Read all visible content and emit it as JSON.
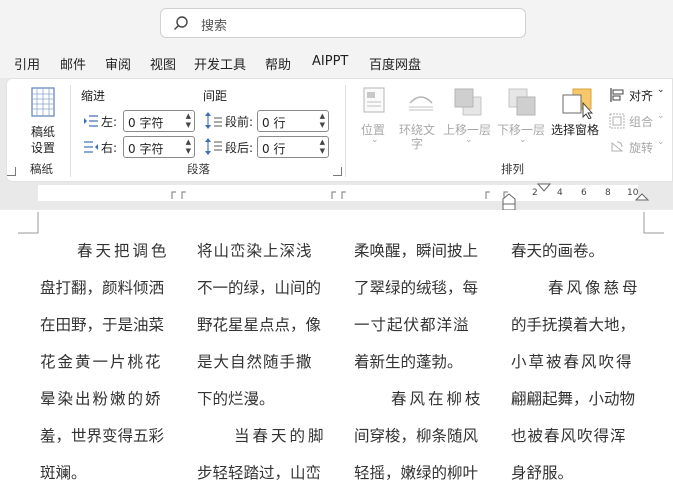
{
  "search": {
    "placeholder": "搜索",
    "icon": "search-icon"
  },
  "menu": {
    "tabs": [
      "引用",
      "邮件",
      "审阅",
      "视图",
      "开发工具",
      "帮助",
      "AIPPT",
      "百度网盘"
    ]
  },
  "ribbon": {
    "paper": {
      "button_line1": "稿纸",
      "button_line2": "设置",
      "group_label": "稿纸"
    },
    "paragraph": {
      "indent_title": "缩进",
      "spacing_title": "间距",
      "left_label": "左:",
      "right_label": "右:",
      "left_value": "0 字符",
      "right_value": "0 字符",
      "before_label": "段前:",
      "after_label": "段后:",
      "before_value": "0 行",
      "after_value": "0 行",
      "group_label": "段落"
    },
    "arrange": {
      "position": "位置",
      "wrap_line1": "环绕文",
      "wrap_line2": "字",
      "bring_forward": "上移一层",
      "send_backward": "下移一层",
      "selection_pane": "选择窗格",
      "align": "对齐",
      "group": "组合",
      "rotate": "旋转",
      "group_label": "排列"
    }
  },
  "ruler": {
    "ticks": [
      "2",
      "4",
      "6",
      "8",
      "10"
    ]
  },
  "document": {
    "columns": [
      [
        "　　春天把调色",
        "盘打翻，颜料倾洒",
        "在田野，于是油菜",
        "花金黄一片桃花",
        "晕染出粉嫩的娇",
        "羞，世界变得五彩",
        "斑斓。"
      ],
      [
        "将山峦染上深浅",
        "不一的绿，山间的",
        "野花星星点点，像",
        "是大自然随手撒",
        "下的烂漫。",
        "　　当春天的脚",
        "步轻轻踏过，山峦"
      ],
      [
        "柔唤醒，瞬间披上",
        "了翠绿的绒毯，每",
        "一寸起伏都洋溢",
        "着新生的蓬勃。",
        "　　春风在柳枝",
        "间穿梭，柳条随风",
        "轻摇，嫩绿的柳叶"
      ],
      [
        "春天的画卷。",
        "　　春风像慈母",
        "的手抚摸着大地，",
        "小草被春风吹得",
        "翩翩起舞，小动物",
        "也被春风吹得浑",
        "身舒服。"
      ]
    ]
  }
}
